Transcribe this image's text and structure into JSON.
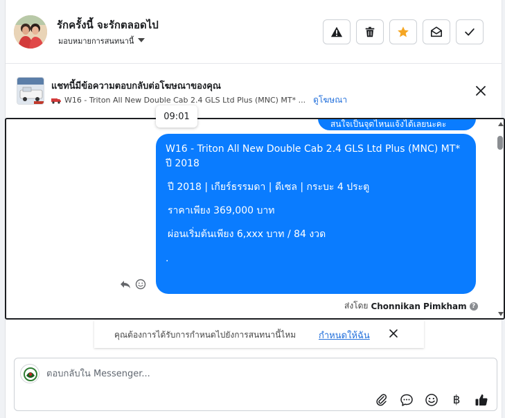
{
  "header": {
    "title": "รักครั้งนี้ จะรักตลอดไป",
    "assign_label": "มอบหมายการสนทนานี้",
    "buttons": [
      "warning-button",
      "delete-button",
      "star-button",
      "mark-unread-button",
      "done-button"
    ],
    "star_color": "#f5a623"
  },
  "ad": {
    "title": "แชทนี้มีข้อความตอบกลับต่อโฆษณาของคุณ",
    "subtitle": "W16 - Triton All New Double Cab 2.4 GLS Ltd Plus (MNC) MT* ...",
    "link": "ดูโฆษณา"
  },
  "tooltip": {
    "time": "09:01"
  },
  "messages": {
    "previous_partial": "สนใจเป็นจุดไหนแจ้งได้เลยนะคะ",
    "bubble": {
      "line1": "W16 - Triton All New Double Cab 2.4 GLS Ltd Plus (MNC) MT*",
      "line2": "ปี 2018",
      "line3": "ปี 2018 |  เกียร์ธรรมดา |  ดีเซล |  กระบะ 4 ประตู",
      "line4": "ราคาเพียง 369,000 บาท",
      "line5": "ผ่อนเริ่มต้นเพียง 6,xxx บาท / 84 งวด",
      "line6": "."
    },
    "bubble_color": "#0a7cff",
    "sent_by_prefix": "ส่งโดย",
    "sent_by_name": "Chonnikan Pimkham"
  },
  "suggestion": {
    "text": "คุณต้องการได้รับการกำหนดไปยังการสนทนานี้ไหม",
    "action": "กำหนดให้ฉัน"
  },
  "composer": {
    "placeholder": "ตอบกลับใน Messenger...",
    "currency_symbol": "฿",
    "tools": [
      "paperclip-icon",
      "comment-icon",
      "emoji-icon",
      "baht-icon",
      "thumbs-up-icon"
    ]
  },
  "colors": {
    "accent": "#216fdb",
    "messenger_blue": "#0a7cff"
  }
}
